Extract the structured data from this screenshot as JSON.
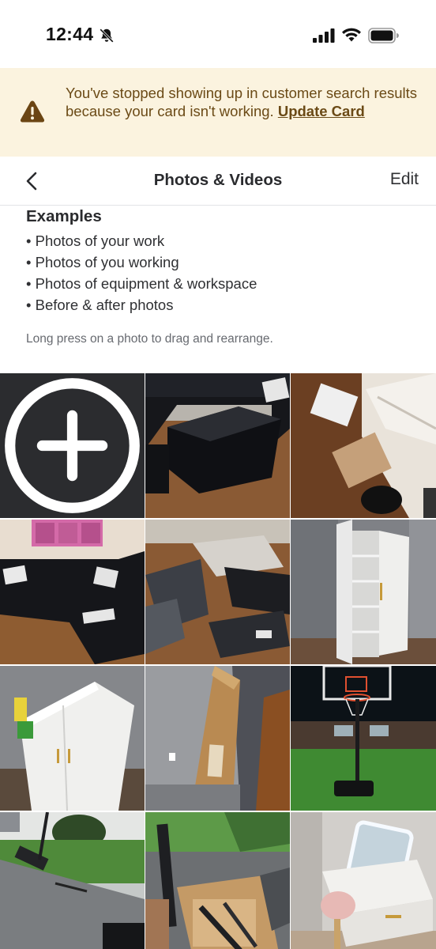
{
  "status_bar": {
    "time": "12:44",
    "icons": [
      "bell-off-icon",
      "signal-icon",
      "wifi-icon",
      "battery-icon"
    ]
  },
  "banner": {
    "icon": "warning-icon",
    "message": "You've stopped showing up in customer search results because your card isn't working. ",
    "link_label": "Update Card",
    "background": "#fbf3df",
    "text_color": "#6b4a16"
  },
  "header": {
    "back_icon": "chevron-left-icon",
    "title": "Photos & Videos",
    "edit_label": "Edit"
  },
  "examples": {
    "title": "Examples",
    "items": [
      "• Photos of your work",
      "• Photos of you working",
      "• Photos of equipment & workspace",
      "• Before & after photos"
    ]
  },
  "hint": "Long press on a photo to drag and rearrange.",
  "gallery": {
    "add_icon": "plus-circle-icon",
    "photos": [
      "photo-black-sectional-sofa-ottoman",
      "photo-stairway-packaging",
      "photo-black-sectional-living-room",
      "photo-unboxed-furniture-parts",
      "photo-white-storage-cabinet",
      "photo-white-wardrobe-doors",
      "photo-boxed-furniture-panel",
      "photo-basketball-hoop-night",
      "photo-basketball-hoop-driveway",
      "photo-basketball-hoop-parts",
      "photo-vanity-mirror-desk"
    ]
  }
}
